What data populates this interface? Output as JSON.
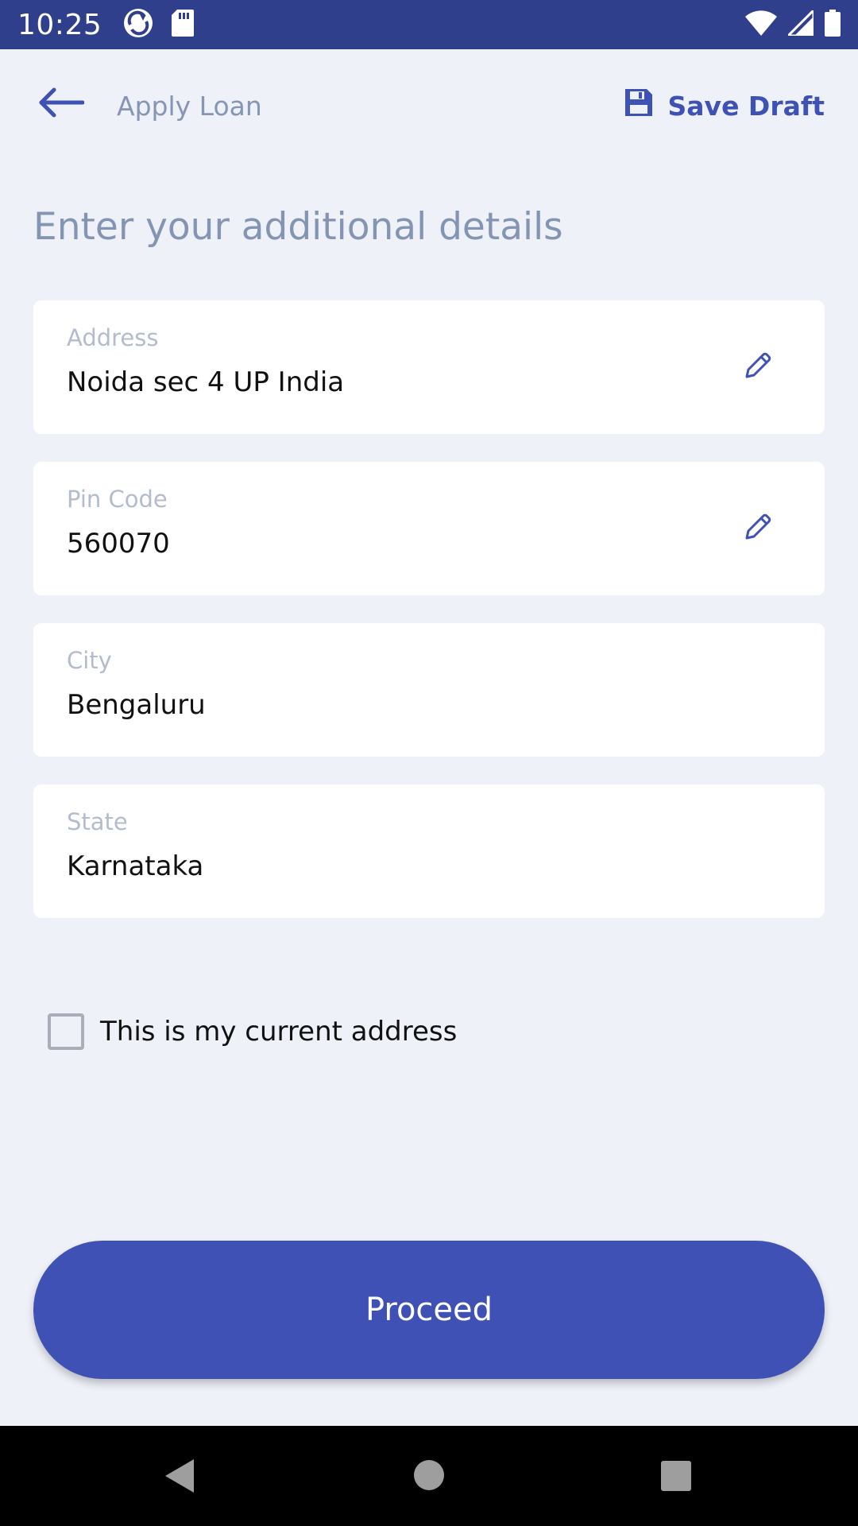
{
  "status_bar": {
    "time": "10:25",
    "icons": [
      "sync-app-icon",
      "sd-card-icon",
      "wifi-icon",
      "signal-icon",
      "battery-icon"
    ]
  },
  "app_bar": {
    "title": "Apply Loan",
    "save_draft_label": "Save Draft",
    "back_icon": "arrow-left-icon",
    "save_icon": "floppy-disk-icon"
  },
  "heading": "Enter your additional details",
  "fields": [
    {
      "label": "Address",
      "value": "Noida sec 4  UP India",
      "editable": true
    },
    {
      "label": "Pin Code",
      "value": "560070",
      "editable": true
    },
    {
      "label": "City",
      "value": "Bengaluru",
      "editable": false
    },
    {
      "label": "State",
      "value": "Karnataka",
      "editable": false
    }
  ],
  "current_address_checkbox": {
    "label": "This is my current address",
    "checked": false
  },
  "proceed_label": "Proceed",
  "nav_bar": {
    "icons": [
      "back-triangle-icon",
      "home-circle-icon",
      "recents-square-icon"
    ]
  },
  "colors": {
    "status_bar": "#303F8C",
    "accent": "#3F51B5",
    "background": "#EEF1F8",
    "muted_text": "#8596B4",
    "label_text": "#B3BCCD"
  }
}
